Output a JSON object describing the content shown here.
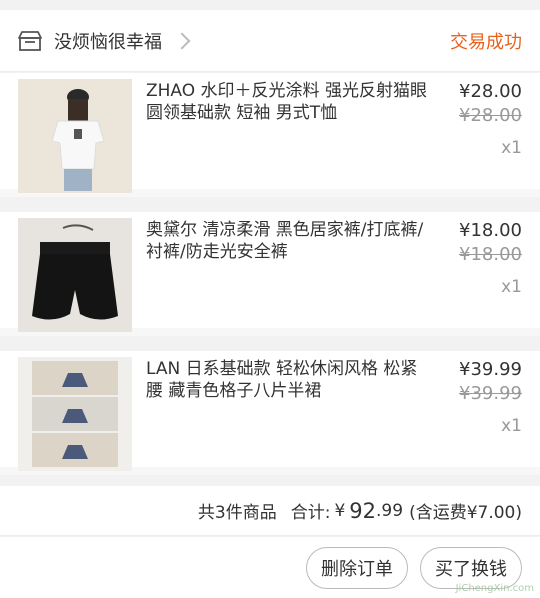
{
  "shop": {
    "name": "没烦恼很幸福",
    "status": "交易成功"
  },
  "items": [
    {
      "title": "ZHAO 水印＋反光涂料 强光反射猫眼 圆领基础款 短袖 男式T恤",
      "price": "¥28.00",
      "original_price": "¥28.00",
      "qty": "x1"
    },
    {
      "title": "奥黛尔 清凉柔滑 黑色居家裤/打底裤/衬裤/防走光安全裤",
      "price": "¥18.00",
      "original_price": "¥18.00",
      "qty": "x1"
    },
    {
      "title": "LAN 日系基础款 轻松休闲风格 松紧腰 藏青色格子八片半裙",
      "price": "¥39.99",
      "original_price": "¥39.99",
      "qty": "x1"
    }
  ],
  "summary": {
    "count_text": "共3件商品",
    "total_label": "合计:",
    "currency": "¥",
    "total_int": "92",
    "total_dec": ".99",
    "shipping": "(含运费¥7.00)"
  },
  "actions": {
    "delete": "删除订单",
    "buy_again": "买了换钱"
  },
  "watermark": "JiChengXin.com",
  "colors": {
    "status": "#e6621f",
    "background": "#f2f2f2"
  }
}
